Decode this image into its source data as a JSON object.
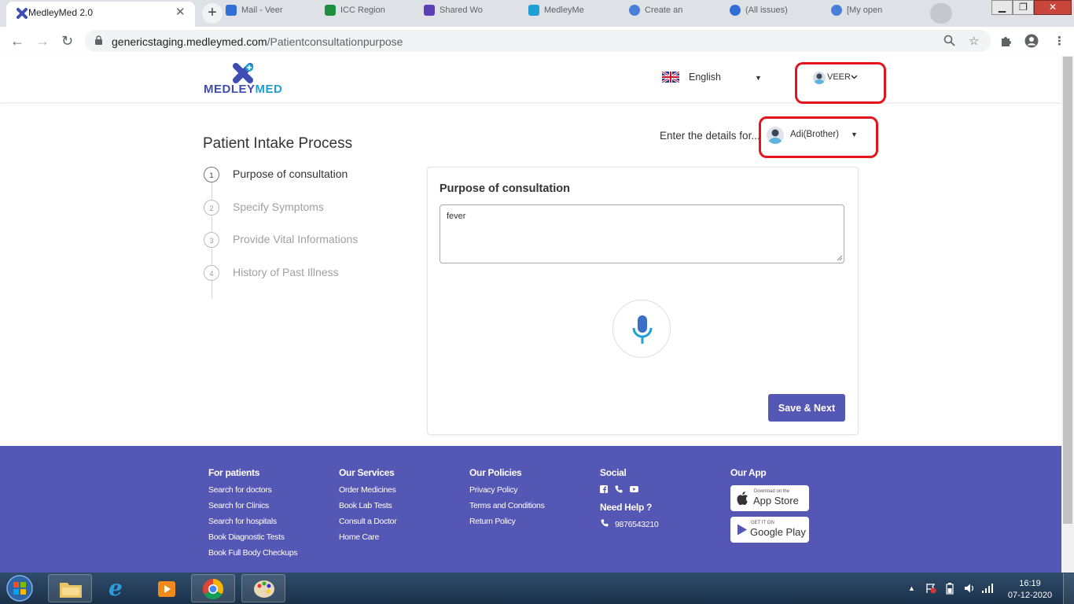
{
  "browser": {
    "active_tab": "MedleyMed 2.0",
    "close_label": "✕",
    "newtab_label": "+",
    "background_tabs": [
      {
        "label": "Mail - Veer",
        "color": "#2f6fd6"
      },
      {
        "label": "ICC Region",
        "color": "#1e8e3e"
      },
      {
        "label": "Shared Wo",
        "color": "#5b3fb3"
      },
      {
        "label": "MedleyMe",
        "color": "#1ea0d6"
      },
      {
        "label": "Create an",
        "color": "#4a7fd8"
      },
      {
        "label": "(All issues)",
        "color": "#2f6fd6"
      },
      {
        "label": "[My open",
        "color": "#4a7fd8"
      }
    ],
    "url_host": "genericstaging.medleymed.com",
    "url_path": "/Patientconsultationpurpose"
  },
  "header": {
    "logo_part1": "MEDLEY",
    "logo_part2": "MED",
    "language": "English",
    "user": "VEER"
  },
  "main": {
    "title": "Patient Intake Process",
    "steps": [
      {
        "num": "1",
        "label": "Purpose of consultation",
        "active": true
      },
      {
        "num": "2",
        "label": "Specify Symptoms",
        "active": false
      },
      {
        "num": "3",
        "label": "Provide Vital Informations",
        "active": false
      },
      {
        "num": "4",
        "label": "History of Past Illness",
        "active": false
      }
    ],
    "enter_details": "Enter the details for...",
    "selected_member": "Adi(Brother)",
    "card_title": "Purpose of consultation",
    "purpose_value": "fever",
    "save_next": "Save & Next"
  },
  "footer": {
    "for_patients": {
      "heading": "For patients",
      "links": [
        "Search for doctors",
        "Search for Clinics",
        "Search for hospitals",
        "Book Diagnostic Tests",
        "Book Full Body Checkups"
      ]
    },
    "our_services": {
      "heading": "Our Services",
      "links": [
        "Order Medicines",
        "Book Lab Tests",
        "Consult a Doctor",
        "Home Care"
      ]
    },
    "our_policies": {
      "heading": "Our Policies",
      "links": [
        "Privacy Policy",
        "Terms and Conditions",
        "Return Policy"
      ]
    },
    "social": {
      "heading": "Social",
      "need_help": "Need Help ?",
      "phone": "9876543210"
    },
    "our_app": {
      "heading": "Our App",
      "appstore_small": "Download on the",
      "appstore_big": "App Store",
      "googleplay_small": "GET IT ON",
      "googleplay_big": "Google Play"
    }
  },
  "taskbar": {
    "time": "16:19",
    "date": "07-12-2020"
  },
  "colors": {
    "accent": "#5557b5",
    "highlight_box": "#e3151c",
    "logo_blue": "#1ea0d6"
  }
}
